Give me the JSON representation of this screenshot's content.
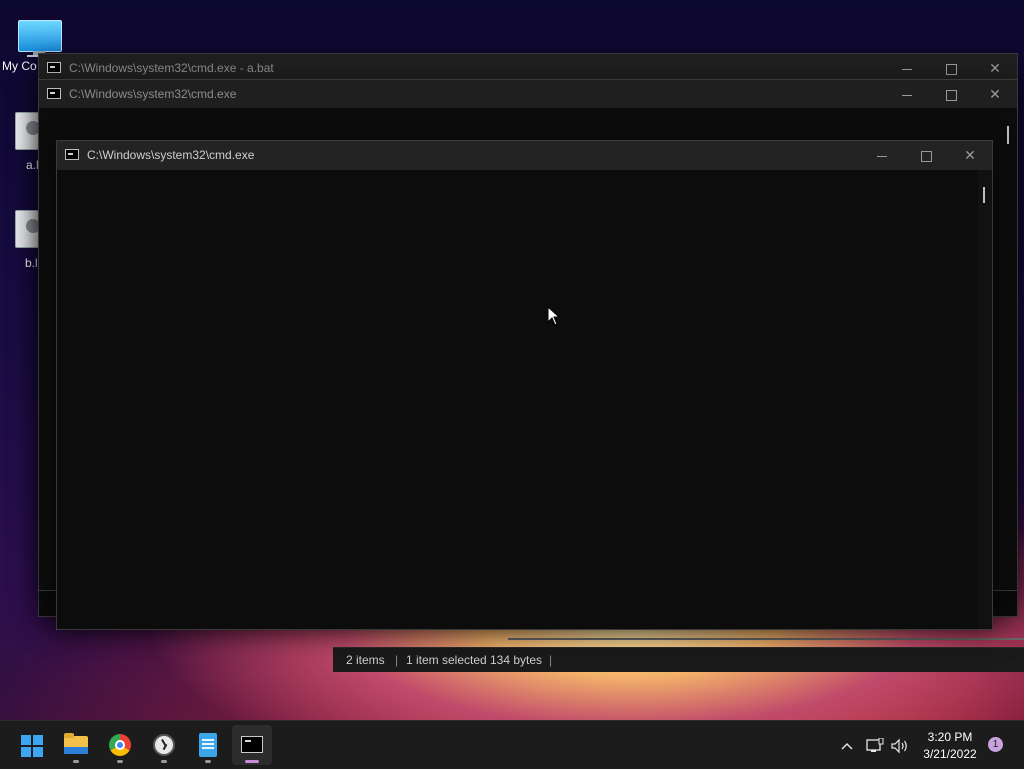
{
  "desktop": {
    "icons": [
      {
        "label": "My Co",
        "kind": "computer"
      },
      {
        "label": "a.l",
        "kind": "batch-file"
      },
      {
        "label": "b.l",
        "kind": "batch-file"
      }
    ]
  },
  "windows": {
    "back": {
      "title": "C:\\Windows\\system32\\cmd.exe - a.bat"
    },
    "middle": {
      "title": "C:\\Windows\\system32\\cmd.exe"
    },
    "front": {
      "title": "C:\\Windows\\system32\\cmd.exe"
    }
  },
  "explorer_status": {
    "items": "2 items",
    "selected": "1 item selected",
    "size": "134 bytes"
  },
  "taskbar": {
    "apps": [
      {
        "name": "start",
        "icon": "windows-logo-icon"
      },
      {
        "name": "file-explorer",
        "icon": "folder-icon"
      },
      {
        "name": "chrome",
        "icon": "chrome-icon"
      },
      {
        "name": "clock",
        "icon": "clock-icon"
      },
      {
        "name": "notepad",
        "icon": "notepad-icon"
      },
      {
        "name": "terminal",
        "icon": "terminal-icon",
        "active": true
      }
    ],
    "tray": {
      "chevron": "^",
      "time": "3:20 PM",
      "date": "3/21/2022",
      "notifications": "1"
    }
  },
  "colors": {
    "accent": "#c58bd8",
    "titlebar": "#1f1f1f",
    "console_bg": "#0c0c0c"
  }
}
